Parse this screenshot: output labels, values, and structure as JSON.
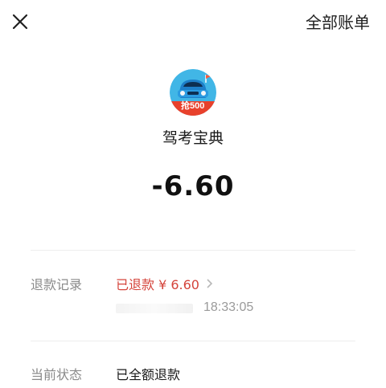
{
  "header": {
    "close_icon": "close-icon",
    "all_bills_label": "全部账单"
  },
  "merchant": {
    "logo_icon": "car-logo",
    "logo_badge": "抢500",
    "name": "驾考宝典"
  },
  "transaction": {
    "amount": "-6.60"
  },
  "details": {
    "refund_record_label": "退款记录",
    "refund_record_value": "已退款 ¥ 6.60",
    "refund_time": "18:33:05",
    "status_label": "当前状态",
    "status_value": "已全额退款"
  },
  "colors": {
    "refund_red": "#d4443b",
    "logo_blue": "#41b6e6"
  }
}
